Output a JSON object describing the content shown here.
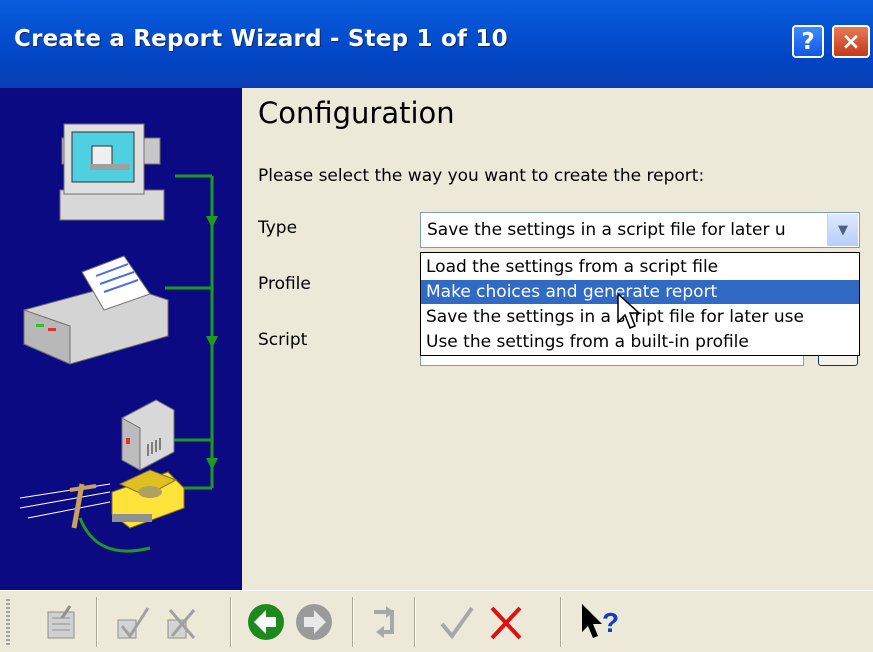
{
  "window": {
    "title": "Create a Report Wizard - Step 1 of 10",
    "help_glyph": "?",
    "close_glyph": "×"
  },
  "content": {
    "heading": "Configuration",
    "prompt": "Please select the way you want to create the report:",
    "type_label": "Type",
    "profile_label": "Profile",
    "script_label": "Script",
    "type_value": "Save the settings in a script file for later u",
    "type_options": [
      "Load the settings from a script file",
      "Make choices and generate report",
      "Save the settings in a script file for later use",
      "Use the settings from a built-in profile"
    ],
    "highlighted_option_index": 1
  },
  "toolbar": {
    "icons": [
      "properties-icon",
      "check-select-icon",
      "cross-select-icon",
      "back-arrow-icon",
      "forward-arrow-icon",
      "return-icon",
      "checkmark-icon",
      "cancel-x-icon",
      "whats-this-help-icon"
    ]
  },
  "colors": {
    "titlebar": "#0a5ddd",
    "left_panel": "#0c0a82",
    "selection": "#316ac5",
    "back_green": "#1e8a1e",
    "cancel_red": "#e01010"
  }
}
